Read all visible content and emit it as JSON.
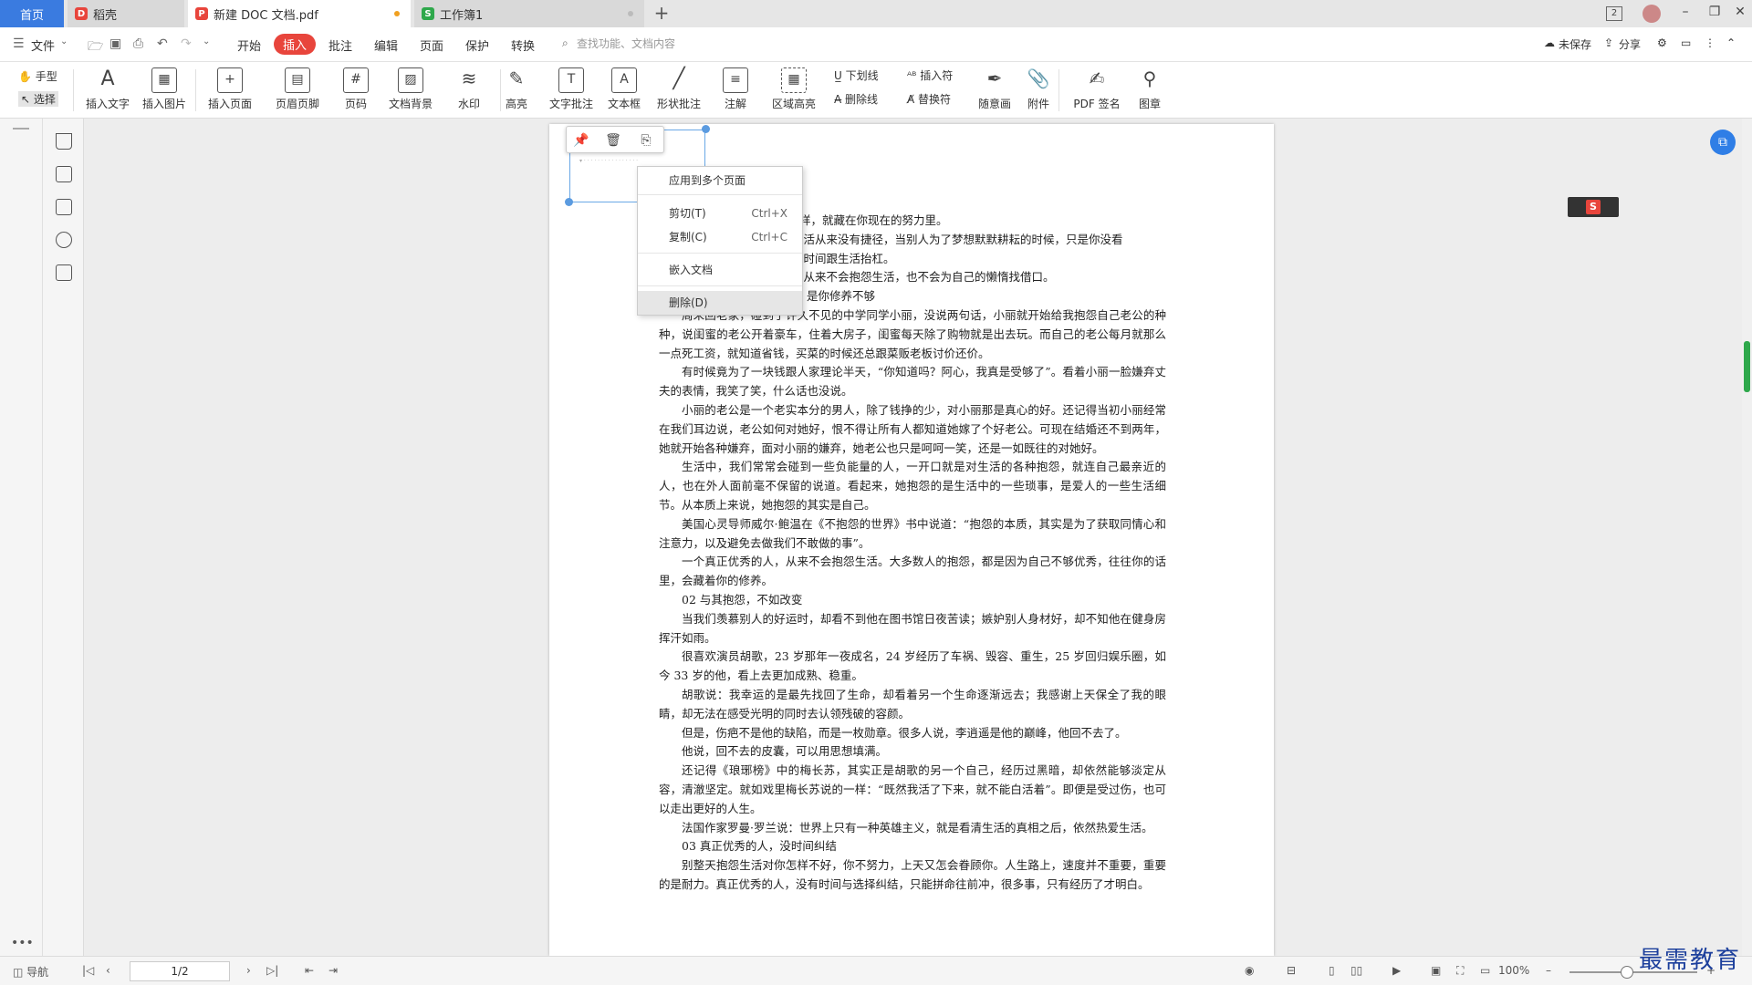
{
  "tabs": {
    "home": "首页",
    "daoke": "稻壳",
    "pdf": "新建 DOC 文档.pdf",
    "xls": "工作簿1",
    "add": "+"
  },
  "window": {
    "badge": "2"
  },
  "menu": {
    "file": "文件",
    "start": "开始",
    "insert": "插入",
    "annotate": "批注",
    "edit": "编辑",
    "page": "页面",
    "protect": "保护",
    "convert": "转换",
    "search_placeholder": "查找功能、文档内容",
    "unsaved": "未保存",
    "share": "分享"
  },
  "ribbon": {
    "hand": "手型",
    "select": "选择",
    "insert_text": "插入文字",
    "insert_image": "插入图片",
    "insert_page": "插入页面",
    "header_footer": "页眉页脚",
    "page_number": "页码",
    "doc_background": "文档背景",
    "watermark": "水印",
    "highlight": "高亮",
    "text_note": "文字批注",
    "text_box": "文本框",
    "shape_note": "形状批注",
    "annotation": "注解",
    "area_highlight": "区域高亮",
    "underline": "下划线",
    "delete_line": "删除线",
    "insert_char": "插入符",
    "replace_char": "替换符",
    "freehand": "随意画",
    "attachment": "附件",
    "pdf_sign": "PDF 签名",
    "stamp": "图章"
  },
  "context_menu": {
    "apply_multi": "应用到多个页面",
    "cut": "剪切(T)",
    "cut_key": "Ctrl+X",
    "copy": "复制(C)",
    "copy_key": "Ctrl+C",
    "embed": "嵌入文档",
    "delete": "删除(D)"
  },
  "doc": {
    "partial": [
      "样，就藏在你现在的努力里。",
      "生活从来没有捷径，当别人为了梦想默默耕耘的时候，只是你没看",
      "没时间跟生活抬杠。",
      "，从来不会抱怨生活，也不会为自己的懒惰找借口。",
      "是你修养不够"
    ],
    "paragraphs": [
      {
        "indent": true,
        "text": "周末回老家，碰到了许久不见的中学同学小丽，没说两句话，小丽就开始给我抱怨自己老公的种种，说闺蜜的老公开着豪车，住着大房子，闺蜜每天除了购物就是出去玩。而自己的老公每月就那么一点死工资，就知道省钱，买菜的时候还总跟菜贩老板讨价还价。"
      },
      {
        "indent": true,
        "text": "有时候竟为了一块钱跟人家理论半天，“你知道吗？阿心，我真是受够了”。看着小丽一脸嫌弃丈夫的表情，我笑了笑，什么话也没说。"
      },
      {
        "indent": true,
        "text": "小丽的老公是一个老实本分的男人，除了钱挣的少，对小丽那是真心的好。还记得当初小丽经常在我们耳边说，老公如何对她好，恨不得让所有人都知道她嫁了个好老公。可现在结婚还不到两年，她就开始各种嫌弃，面对小丽的嫌弃，她老公也只是呵呵一笑，还是一如既往的对她好。"
      },
      {
        "indent": true,
        "text": "生活中，我们常常会碰到一些负能量的人，一开口就是对生活的各种抱怨，就连自己最亲近的人，也在外人面前毫不保留的说道。看起来，她抱怨的是生活中的一些琐事，是爱人的一些生活细节。从本质上来说，她抱怨的其实是自己。"
      },
      {
        "indent": true,
        "text": "美国心灵导师威尔·鲍温在《不抱怨的世界》书中说道：“抱怨的本质，其实是为了获取同情心和注意力，以及避免去做我们不敢做的事”。"
      },
      {
        "indent": true,
        "text": "一个真正优秀的人，从来不会抱怨生活。大多数人的抱怨，都是因为自己不够优秀，往往你的话里，会藏着你的修养。"
      },
      {
        "indent": true,
        "text": "02 与其抱怨，不如改变"
      },
      {
        "indent": true,
        "text": "当我们羡慕别人的好运时，却看不到他在图书馆日夜苦读；嫉妒别人身材好，却不知他在健身房挥汗如雨。"
      },
      {
        "indent": true,
        "text": "很喜欢演员胡歌，23 岁那年一夜成名，24 岁经历了车祸、毁容、重生，25 岁回归娱乐圈，如今 33 岁的他，看上去更加成熟、稳重。"
      },
      {
        "indent": true,
        "text": "胡歌说：我幸运的是最先找回了生命，却看着另一个生命逐渐远去；我感谢上天保全了我的眼睛，却无法在感受光明的同时去认领残破的容颜。"
      },
      {
        "indent": true,
        "text": "但是，伤疤不是他的缺陷，而是一枚勋章。很多人说，李逍遥是他的巅峰，他回不去了。"
      },
      {
        "indent": true,
        "text": "他说，回不去的皮囊，可以用思想填满。"
      },
      {
        "indent": true,
        "text": "还记得《琅琊榜》中的梅长苏，其实正是胡歌的另一个自己，经历过黑暗，却依然能够淡定从容，清澈坚定。就如戏里梅长苏说的一样：“既然我活了下来，就不能白活着”。即便是受过伤，也可以走出更好的人生。"
      },
      {
        "indent": true,
        "text": "法国作家罗曼·罗兰说：世界上只有一种英雄主义，就是看清生活的真相之后，依然热爱生活。"
      },
      {
        "indent": true,
        "text": "03 真正优秀的人，没时间纠结"
      },
      {
        "indent": true,
        "text": "别整天抱怨生活对你怎样不好，你不努力，上天又怎会眷顾你。人生路上，速度并不重要，重要的是耐力。真正优秀的人，没有时间与选择纠结，只能拼命往前冲，很多事，只有经历了才明白。"
      }
    ]
  },
  "status": {
    "nav": "导航",
    "page": "1/2",
    "zoom": "100%",
    "zoom_level": 0.45
  },
  "watermark_text": "最需教育",
  "colors": {
    "accent_blue": "#3a7be0",
    "insert_red": "#e8453c",
    "scroll_green": "#2ea84b"
  }
}
